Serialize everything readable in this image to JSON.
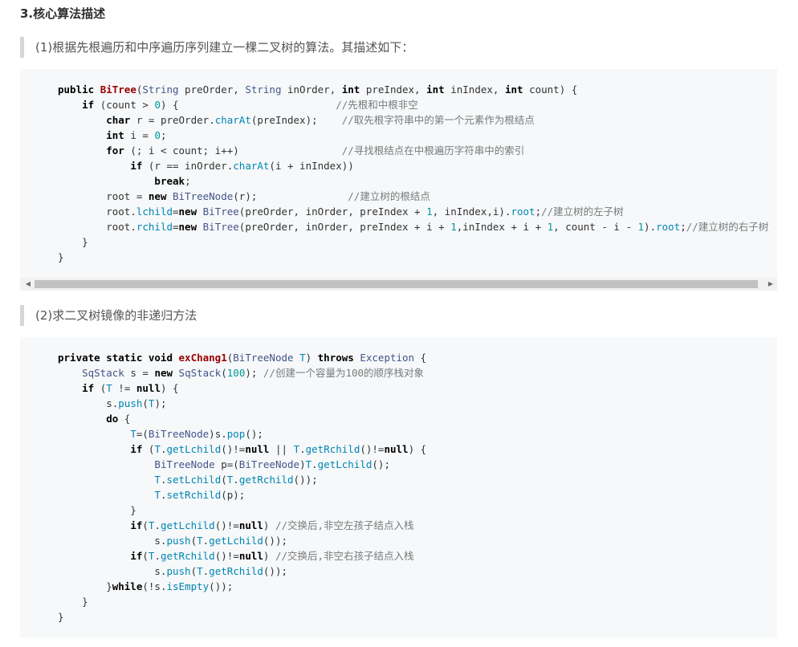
{
  "section_heading": "3.核心算法描述",
  "quote1": "(1)根据先根遍历和中序遍历序列建立一棵二叉树的算法。其描述如下：",
  "quote2": "(2)求二叉树镜像的非递归方法",
  "scrollbar": {
    "left_arrow": "◀",
    "right_arrow": "▶"
  },
  "code1": [
    [
      [
        "k",
        "public "
      ],
      [
        "fn",
        "BiTree"
      ],
      [
        "p",
        "("
      ],
      [
        "t",
        "String"
      ],
      [
        "p",
        " preOrder, "
      ],
      [
        "t",
        "String"
      ],
      [
        "p",
        " inOrder, "
      ],
      [
        "k",
        "int"
      ],
      [
        "p",
        " preIndex, "
      ],
      [
        "k",
        "int"
      ],
      [
        "p",
        " inIndex, "
      ],
      [
        "k",
        "int"
      ],
      [
        "p",
        " count) {"
      ]
    ],
    [
      [
        "p",
        "    "
      ],
      [
        "k",
        "if"
      ],
      [
        "p",
        " (count > "
      ],
      [
        "n",
        "0"
      ],
      [
        "p",
        ") {                          "
      ],
      [
        "c",
        "//先根和中根非空"
      ]
    ],
    [
      [
        "p",
        "        "
      ],
      [
        "k",
        "char"
      ],
      [
        "p",
        " r = preOrder."
      ],
      [
        "m",
        "charAt"
      ],
      [
        "p",
        "(preIndex);    "
      ],
      [
        "c",
        "//取先根字符串中的第一个元素作为根结点"
      ]
    ],
    [
      [
        "p",
        "        "
      ],
      [
        "k",
        "int"
      ],
      [
        "p",
        " i = "
      ],
      [
        "n",
        "0"
      ],
      [
        "p",
        ";"
      ]
    ],
    [
      [
        "p",
        "        "
      ],
      [
        "k",
        "for"
      ],
      [
        "p",
        " (; i < count; i++)                 "
      ],
      [
        "c",
        "//寻找根结点在中根遍历字符串中的索引"
      ]
    ],
    [
      [
        "p",
        "            "
      ],
      [
        "k",
        "if"
      ],
      [
        "p",
        " (r == inOrder."
      ],
      [
        "m",
        "charAt"
      ],
      [
        "p",
        "(i + inIndex))"
      ]
    ],
    [
      [
        "p",
        "                "
      ],
      [
        "k",
        "break"
      ],
      [
        "p",
        ";"
      ]
    ],
    [
      [
        "p",
        "        root = "
      ],
      [
        "k",
        "new "
      ],
      [
        "t",
        "BiTreeNode"
      ],
      [
        "p",
        "(r);               "
      ],
      [
        "c",
        "//建立树的根结点"
      ]
    ],
    [
      [
        "p",
        "        root."
      ],
      [
        "m",
        "lchild"
      ],
      [
        "p",
        "="
      ],
      [
        "k",
        "new "
      ],
      [
        "t",
        "BiTree"
      ],
      [
        "p",
        "(preOrder, inOrder, preIndex + "
      ],
      [
        "n",
        "1"
      ],
      [
        "p",
        ", inIndex,i)."
      ],
      [
        "m",
        "root"
      ],
      [
        "p",
        ";"
      ],
      [
        "c",
        "//建立树的左子树"
      ]
    ],
    [
      [
        "p",
        "        root."
      ],
      [
        "m",
        "rchild"
      ],
      [
        "p",
        "="
      ],
      [
        "k",
        "new "
      ],
      [
        "t",
        "BiTree"
      ],
      [
        "p",
        "(preOrder, inOrder, preIndex + i + "
      ],
      [
        "n",
        "1"
      ],
      [
        "p",
        ",inIndex + i + "
      ],
      [
        "n",
        "1"
      ],
      [
        "p",
        ", count - i - "
      ],
      [
        "n",
        "1"
      ],
      [
        "p",
        ")."
      ],
      [
        "m",
        "root"
      ],
      [
        "p",
        ";"
      ],
      [
        "c",
        "//建立树的右子树"
      ]
    ],
    [
      [
        "p",
        "    }"
      ]
    ],
    [
      [
        "p",
        "}"
      ]
    ]
  ],
  "code2": [
    [
      [
        "k",
        "private static void "
      ],
      [
        "fn",
        "exChang1"
      ],
      [
        "p",
        "("
      ],
      [
        "t",
        "BiTreeNode"
      ],
      [
        "p",
        " "
      ],
      [
        "m",
        "T"
      ],
      [
        "p",
        ") "
      ],
      [
        "k",
        "throws "
      ],
      [
        "t",
        "Exception"
      ],
      [
        "p",
        " {"
      ]
    ],
    [
      [
        "p",
        "    "
      ],
      [
        "t",
        "SqStack"
      ],
      [
        "p",
        " s = "
      ],
      [
        "k",
        "new "
      ],
      [
        "t",
        "SqStack"
      ],
      [
        "p",
        "("
      ],
      [
        "n",
        "100"
      ],
      [
        "p",
        "); "
      ],
      [
        "c",
        "//创建一个容量为100的顺序栈对象"
      ]
    ],
    [
      [
        "p",
        "    "
      ],
      [
        "k",
        "if"
      ],
      [
        "p",
        " ("
      ],
      [
        "m",
        "T"
      ],
      [
        "p",
        " != "
      ],
      [
        "k",
        "null"
      ],
      [
        "p",
        ") {"
      ]
    ],
    [
      [
        "p",
        "        s."
      ],
      [
        "m",
        "push"
      ],
      [
        "p",
        "("
      ],
      [
        "m",
        "T"
      ],
      [
        "p",
        ");"
      ]
    ],
    [
      [
        "p",
        "        "
      ],
      [
        "k",
        "do"
      ],
      [
        "p",
        " {"
      ]
    ],
    [
      [
        "p",
        "            "
      ],
      [
        "m",
        "T"
      ],
      [
        "p",
        "=("
      ],
      [
        "t",
        "BiTreeNode"
      ],
      [
        "p",
        ")s."
      ],
      [
        "m",
        "pop"
      ],
      [
        "p",
        "();"
      ]
    ],
    [
      [
        "p",
        "            "
      ],
      [
        "k",
        "if"
      ],
      [
        "p",
        " ("
      ],
      [
        "m",
        "T"
      ],
      [
        "p",
        "."
      ],
      [
        "m",
        "getLchild"
      ],
      [
        "p",
        "()!="
      ],
      [
        "k",
        "null"
      ],
      [
        "p",
        " || "
      ],
      [
        "m",
        "T"
      ],
      [
        "p",
        "."
      ],
      [
        "m",
        "getRchild"
      ],
      [
        "p",
        "()!="
      ],
      [
        "k",
        "null"
      ],
      [
        "p",
        ") {"
      ]
    ],
    [
      [
        "p",
        "                "
      ],
      [
        "t",
        "BiTreeNode"
      ],
      [
        "p",
        " p=("
      ],
      [
        "t",
        "BiTreeNode"
      ],
      [
        "p",
        ")"
      ],
      [
        "m",
        "T"
      ],
      [
        "p",
        "."
      ],
      [
        "m",
        "getLchild"
      ],
      [
        "p",
        "();"
      ]
    ],
    [
      [
        "p",
        "                "
      ],
      [
        "m",
        "T"
      ],
      [
        "p",
        "."
      ],
      [
        "m",
        "setLchild"
      ],
      [
        "p",
        "("
      ],
      [
        "m",
        "T"
      ],
      [
        "p",
        "."
      ],
      [
        "m",
        "getRchild"
      ],
      [
        "p",
        "());"
      ]
    ],
    [
      [
        "p",
        "                "
      ],
      [
        "m",
        "T"
      ],
      [
        "p",
        "."
      ],
      [
        "m",
        "setRchild"
      ],
      [
        "p",
        "(p);"
      ]
    ],
    [
      [
        "p",
        "            }"
      ]
    ],
    [
      [
        "p",
        "            "
      ],
      [
        "k",
        "if"
      ],
      [
        "p",
        "("
      ],
      [
        "m",
        "T"
      ],
      [
        "p",
        "."
      ],
      [
        "m",
        "getLchild"
      ],
      [
        "p",
        "()!="
      ],
      [
        "k",
        "null"
      ],
      [
        "p",
        ") "
      ],
      [
        "c",
        "//交换后,非空左孩子结点入栈"
      ]
    ],
    [
      [
        "p",
        "                s."
      ],
      [
        "m",
        "push"
      ],
      [
        "p",
        "("
      ],
      [
        "m",
        "T"
      ],
      [
        "p",
        "."
      ],
      [
        "m",
        "getLchild"
      ],
      [
        "p",
        "());"
      ]
    ],
    [
      [
        "p",
        "            "
      ],
      [
        "k",
        "if"
      ],
      [
        "p",
        "("
      ],
      [
        "m",
        "T"
      ],
      [
        "p",
        "."
      ],
      [
        "m",
        "getRchild"
      ],
      [
        "p",
        "()!="
      ],
      [
        "k",
        "null"
      ],
      [
        "p",
        ") "
      ],
      [
        "c",
        "//交换后,非空右孩子结点入栈"
      ]
    ],
    [
      [
        "p",
        "                s."
      ],
      [
        "m",
        "push"
      ],
      [
        "p",
        "("
      ],
      [
        "m",
        "T"
      ],
      [
        "p",
        "."
      ],
      [
        "m",
        "getRchild"
      ],
      [
        "p",
        "());"
      ]
    ],
    [
      [
        "p",
        "        }"
      ],
      [
        "k",
        "while"
      ],
      [
        "p",
        "(!s."
      ],
      [
        "m",
        "isEmpty"
      ],
      [
        "p",
        "());"
      ]
    ],
    [
      [
        "p",
        "    }"
      ]
    ],
    [
      [
        "p",
        "}"
      ]
    ]
  ]
}
